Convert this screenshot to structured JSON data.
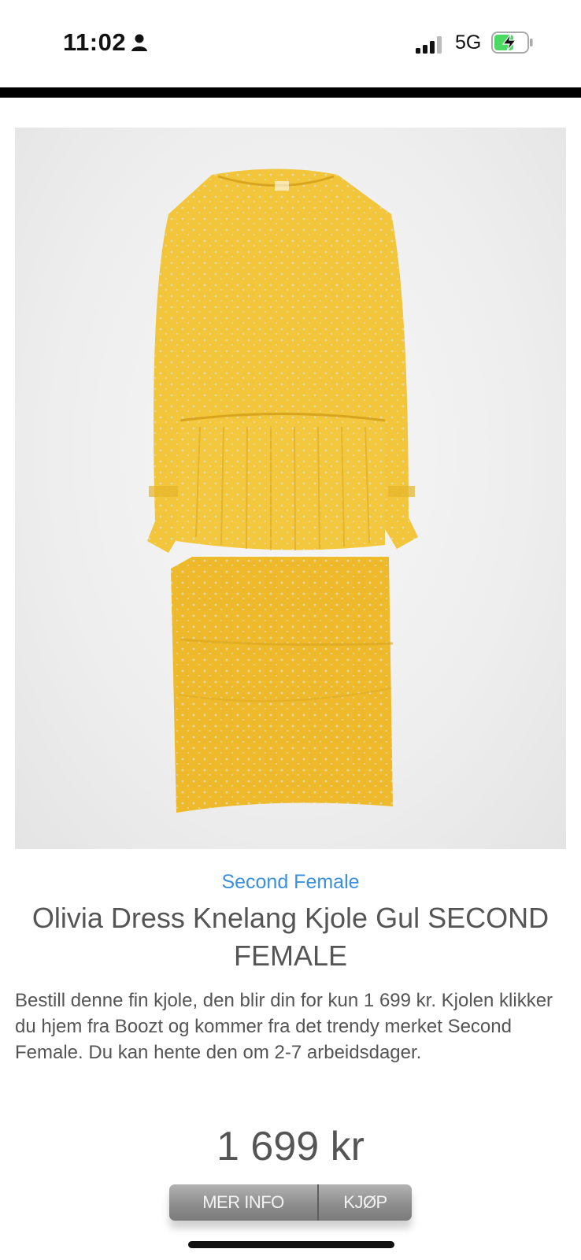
{
  "status_bar": {
    "time": "11:02",
    "network": "5G",
    "icons": [
      "person-icon",
      "signal-bars-icon",
      "battery-charging-icon"
    ],
    "battery_color": "#4cd964"
  },
  "product": {
    "image_description": "yellow-dress-photo",
    "brand": "Second Female",
    "title": "Olivia Dress Knelang Kjole Gul SECOND FEMALE",
    "description": "Bestill denne fin kjole, den blir din for kun 1 699 kr. Kjolen klikker du hjem fra Boozt og kommer fra det trendy merket Second Female. Du kan hente den om 2-7 arbeidsdager.",
    "price": "1 699 kr"
  },
  "buttons": {
    "info_label": "MER INFO",
    "buy_label": "KJØP"
  },
  "colors": {
    "link": "#3b8fde",
    "text": "#555555",
    "dress": "#f2c53a",
    "button": "#8e8e8e"
  }
}
